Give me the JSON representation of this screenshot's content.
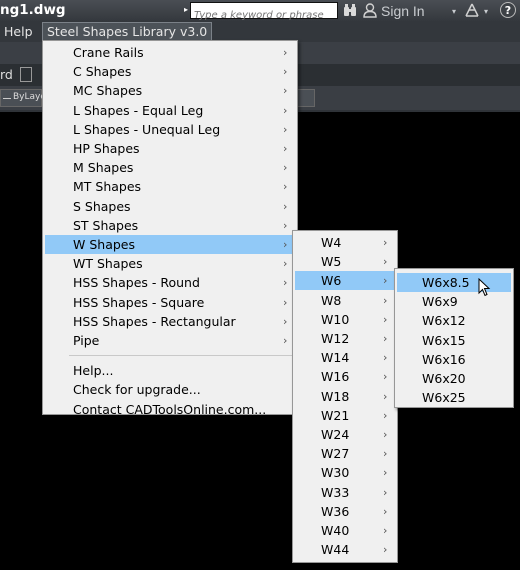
{
  "window": {
    "title": "ng1.dwg"
  },
  "search": {
    "placeholder": "Type a keyword or phrase"
  },
  "account": {
    "sign_in": "Sign In"
  },
  "help_icon_label": "?",
  "menubar": {
    "help": "Help",
    "steel_shapes": "Steel Shapes Library v3.0"
  },
  "ribbon": {
    "partial_label": "rd",
    "bylayer": "ByLaye"
  },
  "steel_menu": {
    "items": [
      {
        "label": "Crane Rails",
        "submenu": true
      },
      {
        "label": "C Shapes",
        "submenu": true
      },
      {
        "label": "MC Shapes",
        "submenu": true
      },
      {
        "label": "L Shapes - Equal Leg",
        "submenu": true
      },
      {
        "label": "L Shapes - Unequal Leg",
        "submenu": true
      },
      {
        "label": "HP Shapes",
        "submenu": true
      },
      {
        "label": "M Shapes",
        "submenu": true
      },
      {
        "label": "MT Shapes",
        "submenu": true
      },
      {
        "label": "S Shapes",
        "submenu": true
      },
      {
        "label": "ST Shapes",
        "submenu": true
      },
      {
        "label": "W Shapes",
        "submenu": true,
        "highlighted": true
      },
      {
        "label": "WT Shapes",
        "submenu": true
      },
      {
        "label": "HSS Shapes - Round",
        "submenu": true
      },
      {
        "label": "HSS Shapes - Square",
        "submenu": true
      },
      {
        "label": "HSS Shapes - Rectangular",
        "submenu": true
      },
      {
        "label": "Pipe",
        "submenu": true
      }
    ],
    "extra_items": [
      {
        "label": "Help..."
      },
      {
        "label": "Check for upgrade..."
      },
      {
        "label": "Contact CADToolsOnline.com..."
      }
    ]
  },
  "w_menu": {
    "items": [
      {
        "label": "W4"
      },
      {
        "label": "W5"
      },
      {
        "label": "W6",
        "highlighted": true
      },
      {
        "label": "W8"
      },
      {
        "label": "W10"
      },
      {
        "label": "W12"
      },
      {
        "label": "W14"
      },
      {
        "label": "W16"
      },
      {
        "label": "W18"
      },
      {
        "label": "W21"
      },
      {
        "label": "W24"
      },
      {
        "label": "W27"
      },
      {
        "label": "W30"
      },
      {
        "label": "W33"
      },
      {
        "label": "W36"
      },
      {
        "label": "W40"
      },
      {
        "label": "W44"
      }
    ]
  },
  "w6_menu": {
    "items": [
      {
        "label": "W6x8.5",
        "highlighted": true
      },
      {
        "label": "W6x9"
      },
      {
        "label": "W6x12"
      },
      {
        "label": "W6x15"
      },
      {
        "label": "W6x16"
      },
      {
        "label": "W6x20"
      },
      {
        "label": "W6x25"
      }
    ]
  },
  "submenu_arrow": "›",
  "colors": {
    "highlight": "#91c9f7",
    "menu_bg": "#f0f0f0",
    "titlebar": "#3b3f45",
    "canvas": "#000000"
  }
}
